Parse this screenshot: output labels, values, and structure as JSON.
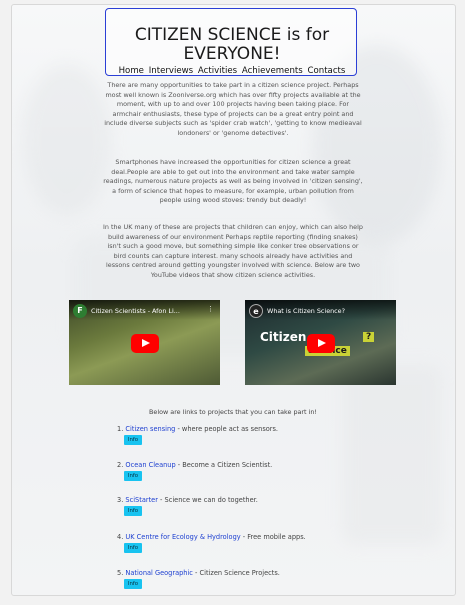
{
  "header": {
    "title": "CITIZEN SCIENCE is for EVERYONE!",
    "nav": [
      "Home",
      "Interviews",
      "Activities",
      "Achievements",
      "Contacts"
    ]
  },
  "content": {
    "paragraph1": "There are many opportunities to take part in a citizen science project. Perhaps most well known is Zooniverse.org which has over fifty projects available at the moment, with up to and over 100 projects having been taking place. For armchair enthusiasts, these type of projects can be a great entry point and include diverse subjects such as 'spider crab watch', 'getting to know medieaval londoners' or 'genome detectives'.",
    "paragraph2": "Smartphones have increased the opportunities for citizen science a great deal.People are able to get out into the environment and take water sample readings, numerous nature projects as well as being involved in 'citizen sensing', a form of science that hopes to measure, for example, urban pollution from people using wood stoves: trendy but deadly!",
    "paragraph3": "In the UK many of these are projects that children can enjoy, which can also help build awareness of our environment Perhaps reptile reporting (finding snakes) isn't such a good move, but something simple like conker tree observations or bird counts can capture interest. many schools already have activities and lessons centred around getting youngster involved with science. Below are two YouTube videos that show citizen science activities."
  },
  "videos": [
    {
      "channel_initial": "F",
      "title": "Citizen Scientists - Afon Li...",
      "kebab": "⋮"
    },
    {
      "channel_initial": "e",
      "title": "What is Citizen Science?",
      "overlay_word1": "Citizen",
      "overlay_word2": "Science",
      "overlay_q": "?"
    }
  ],
  "links_intro": "Below are links to projects that you can take part in!",
  "projects": [
    {
      "number": "1.",
      "name": "Citizen sensing",
      "desc": " - where people act as sensors.",
      "button": "Info"
    },
    {
      "number": "2.",
      "name": "Ocean Cleanup",
      "desc": " - Become a Citizen Scientist.",
      "button": "Info"
    },
    {
      "number": "3.",
      "name": "SciStarter",
      "desc": " - Science we can do together.",
      "button": "Info"
    },
    {
      "number": "4.",
      "name": "UK Centre for Ecology & Hydrology",
      "desc": " - Free mobile apps.",
      "button": "Info"
    },
    {
      "number": "5.",
      "name": "National Geographic",
      "desc": " - Citizen Science Projects.",
      "button": "Info"
    }
  ],
  "colors": {
    "header_border": "#2b3fd6",
    "info_button": "#18c3f0",
    "play_button": "#ff0000"
  }
}
